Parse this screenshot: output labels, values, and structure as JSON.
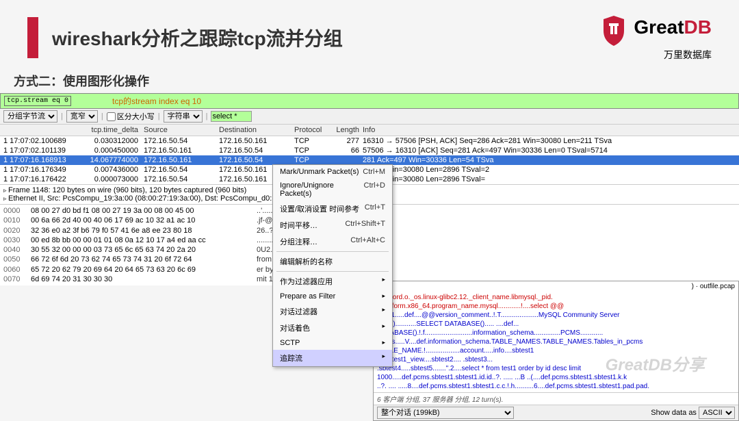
{
  "header": {
    "title": "wireshark分析之跟踪tcp流并分组",
    "brand": "Great",
    "brand_suffix": "DB",
    "brand_sub": "万里数据库"
  },
  "subtitle": "方式二：使用图形化操作",
  "filter": {
    "expr": "tcp.stream eq 0",
    "note": "tcp的stream index eq 10"
  },
  "toolbar": {
    "grp_bytes": "分组字节流",
    "width": "宽窄",
    "case": "区分大小写",
    "strtype": "字符串",
    "search": "select *"
  },
  "cols": {
    "delta": "tcp.time_delta",
    "src": "Source",
    "dst": "Destination",
    "proto": "Protocol",
    "len": "Length",
    "info": "Info"
  },
  "packets": [
    {
      "t": "1 17:07:02.100689",
      "d": "0.030312000",
      "s": "172.16.50.54",
      "ds": "172.16.50.161",
      "p": "TCP",
      "l": "277",
      "i": "16310 → 57506 [PSH, ACK] Seq=286 Ack=281 Win=30080 Len=211 TSva"
    },
    {
      "t": "1 17:07:02.101139",
      "d": "0.000450000",
      "s": "172.16.50.161",
      "ds": "172.16.50.54",
      "p": "TCP",
      "l": "66",
      "i": "57506 → 16310 [ACK] Seq=281 Ack=497 Win=30336 Len=0 TSval=5714"
    },
    {
      "t": "1 17:07:16.168913",
      "d": "14.067774000",
      "s": "172.16.50.161",
      "ds": "172.16.50.54",
      "p": "TCP",
      "l": "",
      "i": "281 Ack=497 Win=30336 Len=54 TSva",
      "sel": true
    },
    {
      "t": "1 17:07:16.176349",
      "d": "0.007436000",
      "s": "172.16.50.54",
      "ds": "172.16.50.161",
      "p": "TCP",
      "l": "",
      "i": "k=335 Win=30080 Len=2896 TSval=2"
    },
    {
      "t": "1 17:07:16.176422",
      "d": "0.000073000",
      "s": "172.16.50.54",
      "ds": "172.16.50.161",
      "p": "TCP",
      "l": "",
      "i": "k=335 Win=30080 Len=2896 TSval="
    }
  ],
  "details": {
    "line1": "Frame 1148: 120 bytes on wire (960 bits), 120 bytes captured (960 bits)",
    "line2": "Ethernet II, Src: PcsCompu_19:3a:00 (08:00:27:19:3a:00), Dst: PcsCompu_d0:bd:f1"
  },
  "hex": [
    {
      "o": "0000",
      "b": "08 00 27 d0 bd f1 08 00  27 19 3a 00 08 00 45 00",
      "a": "..'...... '.:...E."
    },
    {
      "o": "0010",
      "b": "00 6a 66 2d 40 00 40 06  17 69 ac 10 32 a1 ac 10",
      "a": ".jf-@.@ . .i..2..."
    },
    {
      "o": "0020",
      "b": "32 36 e0 a2 3f b6 79 f0  57 41 6e a8 ee 23 80 18",
      "a": "26..?.y. WAn..#.."
    },
    {
      "o": "0030",
      "b": "00 ed 8b bb 00 00 01 01  08 0a 12 10 17 a4 ed aa cc",
      "a": "........ ....\"z..."
    },
    {
      "o": "0040",
      "b": "30 55 32 00 00 00 03 73  65 6c 65 63 74 20 2a 20",
      "a": "0U2....s elect * "
    },
    {
      "o": "0050",
      "b": "66 72 6f 6d 20 73 62 74  65 73 74 31 20 6f 72 64",
      "a": "from sbt est1 ord"
    },
    {
      "o": "0060",
      "b": "65 72 20 62 79 20 69 64  20 64 65 73 63 20 6c 69",
      "a": "er by id  desc li"
    },
    {
      "o": "0070",
      "b": "6d 69 74 20 31 30 30 30                         ",
      "a": "mit 1000"
    }
  ],
  "ctx": {
    "mark": "Mark/Unmark Packet(s)",
    "mark_k": "Ctrl+M",
    "ignore": "Ignore/Unignore Packet(s)",
    "ignore_k": "Ctrl+D",
    "setref": "设置/取消设置 时间参考",
    "setref_k": "Ctrl+T",
    "timeshift": "时间平移…",
    "timeshift_k": "Ctrl+Shift+T",
    "comment": "分组注释…",
    "comment_k": "Ctrl+Alt+C",
    "editname": "编辑解析的名称",
    "asfilter": "作为过滤器应用",
    "prepfilter": "Prepare as Filter",
    "convfilter": "对话过滤器",
    "convcolor": "对话着色",
    "sctp": "SCTP",
    "follow": "追踪流"
  },
  "lower": {
    "path": ") · outfile.pcap",
    "l1": "assword.o._os.linux-glibc2.12._client_name.libmysql._pid.",
    "l2": "_platform.x86_64.program_name.mysql............!....select @@",
    "l3": "limit 1.....def....@@version_comment..!.T....................MySQL Community Server",
    "l4": "(GPL)...........SELECT DATABASE()..... ....def...",
    "l5": "DATABASE().!.f.........................information_schema..............PCMS............",
    "l6": "tables.....V....def.information_schema.TABLE_NAMES.TABLE_NAMES.Tables_in_pcms",
    "l7": "TABLE_NAME.!..................account.....info....sbtest1",
    "l8": "....sbtest1_view....sbtest2.... .sbtest3...",
    "l9": ".sbtest4.....sbtest5.......\".2....select * from test1 order by id desc limit",
    "l10": "1000.....def.pcms.sbtest1.sbtest1.id.id..?. ..... ...B ..(....def.pcms.sbtest1.sbtest1.k.k",
    "l11": "..?. .... .....8....def.pcms.sbtest1.sbtest1.c.c.!.h..........6....def.pcms.sbtest1.sbtest1.pad.pad.",
    "status": "6 客户端 分组, 37 服务器 分组, 12 turn(s).",
    "dialog": "整个对话 (199kB)",
    "showas_lbl": "Show data as",
    "showas_val": "ASCII"
  },
  "watermark": "GreatDB分享"
}
